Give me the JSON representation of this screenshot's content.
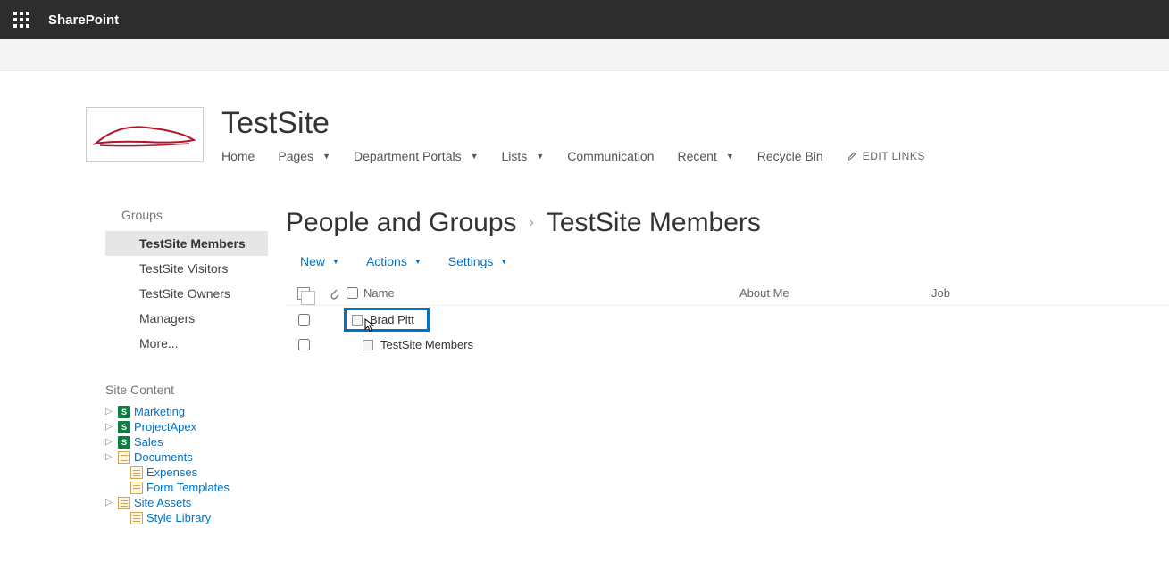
{
  "suite": {
    "app_name": "SharePoint"
  },
  "site": {
    "title": "TestSite"
  },
  "top_nav": {
    "items": [
      {
        "label": "Home",
        "has_dropdown": false
      },
      {
        "label": "Pages",
        "has_dropdown": true
      },
      {
        "label": "Department Portals",
        "has_dropdown": true
      },
      {
        "label": "Lists",
        "has_dropdown": true
      },
      {
        "label": "Communication",
        "has_dropdown": false
      },
      {
        "label": "Recent",
        "has_dropdown": true
      },
      {
        "label": "Recycle Bin",
        "has_dropdown": false
      }
    ],
    "edit_links": "EDIT LINKS"
  },
  "left_nav": {
    "groups_heading": "Groups",
    "groups": [
      {
        "label": "TestSite Members",
        "selected": true
      },
      {
        "label": "TestSite Visitors",
        "selected": false
      },
      {
        "label": "TestSite Owners",
        "selected": false
      },
      {
        "label": "Managers",
        "selected": false
      },
      {
        "label": "More...",
        "selected": false
      }
    ],
    "site_content_heading": "Site Content",
    "tree": [
      {
        "label": "Marketing",
        "icon": "sp",
        "expandable": true,
        "indent": 0
      },
      {
        "label": "ProjectApex",
        "icon": "sp",
        "expandable": true,
        "indent": 0
      },
      {
        "label": "Sales",
        "icon": "sp",
        "expandable": true,
        "indent": 0
      },
      {
        "label": "Documents",
        "icon": "doc",
        "expandable": true,
        "indent": 0
      },
      {
        "label": "Expenses",
        "icon": "doc",
        "expandable": false,
        "indent": 1
      },
      {
        "label": "Form Templates",
        "icon": "doc",
        "expandable": false,
        "indent": 1
      },
      {
        "label": "Site Assets",
        "icon": "doc",
        "expandable": true,
        "indent": 0
      },
      {
        "label": "Style Library",
        "icon": "doc",
        "expandable": false,
        "indent": 1
      }
    ]
  },
  "content": {
    "breadcrumb_root": "People and Groups",
    "breadcrumb_current": "TestSite Members",
    "toolbar": {
      "new": "New",
      "actions": "Actions",
      "settings": "Settings"
    },
    "columns": {
      "name": "Name",
      "about": "About Me",
      "job": "Job"
    },
    "rows": [
      {
        "name": "Brad Pitt",
        "highlighted": true
      },
      {
        "name": "TestSite Members",
        "highlighted": false
      }
    ]
  }
}
